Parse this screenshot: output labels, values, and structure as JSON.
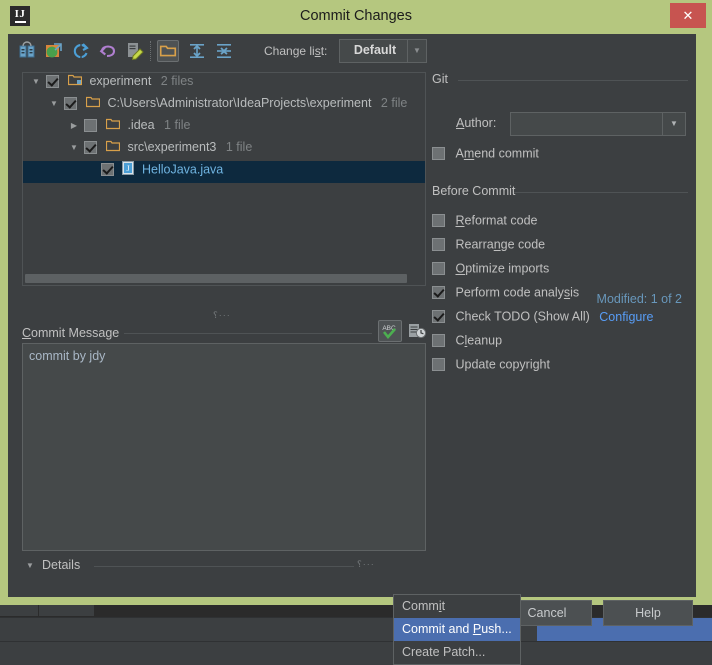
{
  "window": {
    "title": "Commit Changes",
    "app_icon": "intellij-idea-logo",
    "close_label": "✕",
    "titlebar_color": "#b5c77f",
    "body_color": "#3c3f41"
  },
  "toolbar": {
    "icons": [
      {
        "name": "show-diff-icon",
        "title": "Show Diff"
      },
      {
        "name": "move-to-another-changelist-icon",
        "title": "Move to Another Changelist"
      },
      {
        "name": "refresh-icon",
        "title": "Refresh"
      },
      {
        "name": "rollback-icon",
        "title": "Rollback"
      },
      {
        "name": "edit-source-icon",
        "title": "Edit Source"
      },
      {
        "name": "group-by-directory-icon",
        "title": "Group by Directory",
        "selected": true
      },
      {
        "name": "expand-all-icon",
        "title": "Expand All"
      },
      {
        "name": "collapse-all-icon",
        "title": "Collapse All"
      }
    ],
    "changelist_label": "Change li",
    "changelist_label_mnemonic": "s",
    "changelist_label_tail": "t:",
    "changelist_value": "Default",
    "dropdown_caret": "▼"
  },
  "tree": {
    "rows": [
      {
        "indent": 0,
        "twisty": "▼",
        "checked": true,
        "icon": "module-folder-icon",
        "label": "experiment",
        "count": "2 files",
        "selected": false
      },
      {
        "indent": 1,
        "twisty": "▼",
        "checked": true,
        "icon": "folder-icon",
        "label": "C:\\Users\\Administrator\\IdeaProjects\\experiment",
        "count": "2 file",
        "selected": false
      },
      {
        "indent": 2,
        "twisty": "▶",
        "checked": false,
        "icon": "folder-icon",
        "label": ".idea",
        "count": "1 file",
        "selected": false
      },
      {
        "indent": 2,
        "twisty": "▼",
        "checked": true,
        "icon": "folder-icon",
        "label": "src\\experiment3",
        "count": "1 file",
        "selected": false
      },
      {
        "indent": 3,
        "twisty": "",
        "checked": true,
        "icon": "java-file-icon",
        "label": "HelloJava.java",
        "count": "",
        "selected": true
      }
    ],
    "status": "Modified: 1 of 2",
    "status_color": "#6897bb",
    "splitter_handle": "⸮···"
  },
  "commit_message": {
    "label_mnemonic": "C",
    "label": "ommit Message",
    "value": "commit by jdy",
    "spellcheck_icon": "abc-spellcheck-icon",
    "history_icon": "message-history-icon"
  },
  "details": {
    "twisty": "▼",
    "label": "Details"
  },
  "git_section": {
    "title": "Git",
    "author_label_mnemonic": "A",
    "author_label": "uthor:",
    "author_value": "",
    "author_caret": "▼",
    "amend_prefix": "A",
    "amend_mnemonic": "m",
    "amend_suffix": "end commit",
    "amend_checked": false
  },
  "before_commit": {
    "title": "Before Commit",
    "items": [
      {
        "prefix": "",
        "mnemonic": "R",
        "suffix": "eformat code",
        "checked": false,
        "link": ""
      },
      {
        "prefix": "Rearra",
        "mnemonic": "n",
        "suffix": "ge code",
        "checked": false,
        "link": ""
      },
      {
        "prefix": "",
        "mnemonic": "O",
        "suffix": "ptimize imports",
        "checked": false,
        "link": ""
      },
      {
        "prefix": "Perform code analy",
        "mnemonic": "s",
        "suffix": "is",
        "checked": true,
        "link": ""
      },
      {
        "prefix": "Check TODO (Show All)",
        "mnemonic": "",
        "suffix": "",
        "checked": true,
        "link": "Configure"
      },
      {
        "prefix": "C",
        "mnemonic": "l",
        "suffix": "eanup",
        "checked": false,
        "link": ""
      },
      {
        "prefix": "Update copyright",
        "mnemonic": "",
        "suffix": "",
        "checked": false,
        "link": ""
      }
    ],
    "link_color": "#589df6"
  },
  "buttons": {
    "commit_prefix": "Comm",
    "commit_mnemonic": "i",
    "commit_suffix": "t",
    "commit_caret": "▾",
    "cancel": "Cancel",
    "help": "Help"
  },
  "commit_menu": {
    "items": [
      {
        "prefix": "Comm",
        "mnemonic": "i",
        "suffix": "t",
        "highlighted": false
      },
      {
        "prefix": "Commit and ",
        "mnemonic": "P",
        "suffix": "ush...",
        "highlighted": true
      },
      {
        "prefix": "Create Patch...",
        "mnemonic": "",
        "suffix": "",
        "highlighted": false
      }
    ],
    "highlight_color": "#4b6eaf"
  }
}
